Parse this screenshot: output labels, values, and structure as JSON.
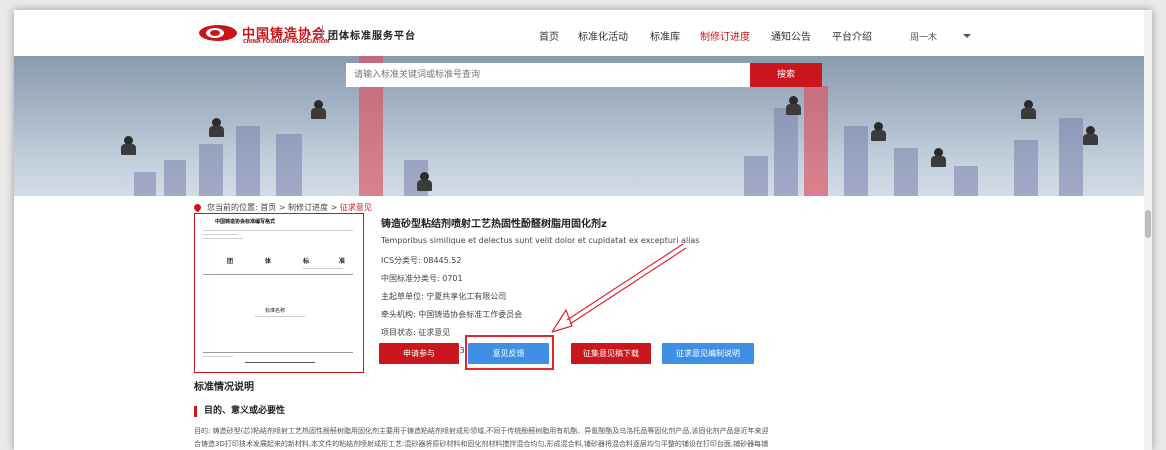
{
  "header": {
    "logo_cn": "中国铸造协会",
    "logo_en": "CHINA FOUNDRY ASSOCIATION",
    "platform": "团体标准服务平台",
    "nav": [
      "首页",
      "标准化活动",
      "标准库",
      "制修订进度",
      "通知公告",
      "平台介绍"
    ],
    "active_nav": "制修订进度",
    "user": "周一木"
  },
  "search": {
    "placeholder": "请输入标准关键词或标准号查询",
    "button": "搜索"
  },
  "breadcrumb": {
    "prefix": "您当前的位置:",
    "items": [
      "首页",
      "制修订进度",
      "征求意见"
    ],
    "separator": ">"
  },
  "cover": {
    "title": "中国铸造协会标准编写格式",
    "big": [
      "团",
      "体",
      "标",
      "准"
    ],
    "name": "标准名称"
  },
  "standard": {
    "title": "铸造砂型粘结剂喷射工艺热固性酚醛树脂用固化剂z",
    "english": "Temporibus similique et delectus sunt velit dolor et cupidatat ex excepturi alias",
    "ics": "ICS分类号: 08445.52",
    "ccs": "中国标准分类号: 0701",
    "drafter": "主起草单位: 宁夏共享化工有限公司",
    "lead": "牵头机构: 中国铸造协会标准工作委员会",
    "status": "项目状态: 征求意见",
    "date": "立项时间: 2021-10-13"
  },
  "buttons": {
    "join": "申请参与",
    "feedback": "意见反馈",
    "download": "征集意见稿下载",
    "explain": "征求意见编制说明"
  },
  "section": {
    "title": "标准情况说明",
    "subtitle": "目的、意义或必要性",
    "para1": "目的: 铸造砂型(芯)粘结剂喷射工艺热固性酚醛树脂用固化剂主要用于铸造粘结剂喷射成形领域,不同于传统酚醛树脂用有机酯、异氰酸酯及乌洛托品等固化剂产品,该固化剂产品是近年来迎",
    "para2": "合铸造3D打印技术发展起来的新材料,本文件的粘结剂喷射成形工艺:混砂器将原砂材料和固化剂材料搅拌混合均匀,形成混合料,铺砂器将混合料逐层均匀平整的铺设在打印台面,铺砂器每铺"
  },
  "colors": {
    "brand_red": "#cb161d",
    "button_blue": "#3f8fe4"
  }
}
